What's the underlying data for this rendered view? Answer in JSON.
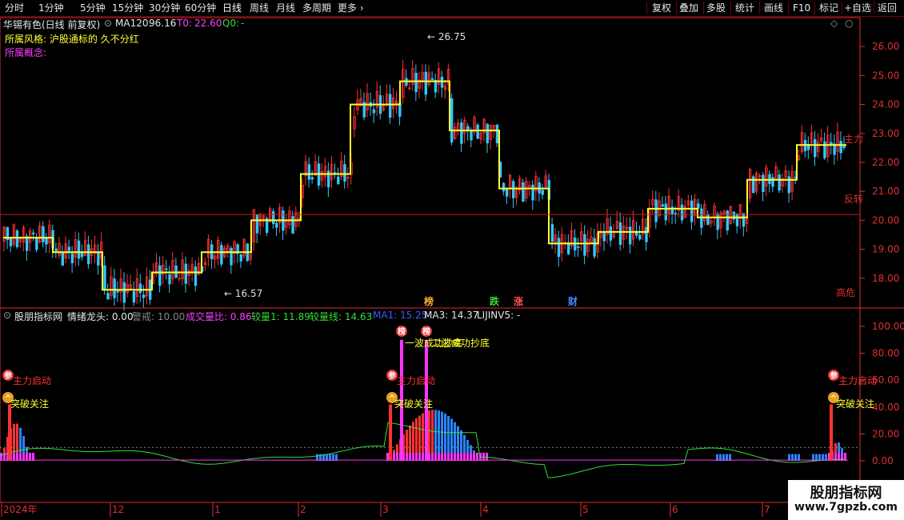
{
  "toolbar": {
    "periods": [
      "分时",
      "1分钟",
      "5分钟",
      "15分钟",
      "30分钟",
      "60分钟",
      "日线",
      "周线",
      "月线",
      "更多"
    ],
    "active_period": "日线",
    "actions": [
      "复权",
      "叠加",
      "多股",
      "统计",
      "画线",
      "F10",
      "标记",
      "+自选",
      "返回"
    ]
  },
  "main_header": {
    "stock": "华锡有色(日线 前复权)",
    "ma120_label": "MA120:",
    "ma120_value": "96.16",
    "t0_label": "T0:",
    "t0_value": "22.60",
    "q0_label": "Q0:",
    "q0_value": "-"
  },
  "notes": {
    "style_label": "所属风格:",
    "style_value": "沪股通标的 久不分红",
    "concept_label": "所属概念:"
  },
  "sub_header": {
    "name": "股朋指标网",
    "qxlt": "情绪龙头: 0.00",
    "jingjie": "警戒: 10.00",
    "cjlb": "成交量比: 0.86",
    "jl1": "较量1: 11.89",
    "jlx": "较量线: 14.63",
    "ma1": "MA1: 15.25",
    "ma3": "MA3: 14.37",
    "lijin": "LIJINV5: -"
  },
  "colors": {
    "up": "#ff3232",
    "down": "#2a84ff",
    "ma": "#ffff33",
    "axis": "#e03030",
    "green": "#33dd33",
    "magenta": "#ff33ff"
  },
  "chart_data": [
    {
      "type": "candlestick",
      "title": "华锡有色(日线 前复权)",
      "y_axis": {
        "ticks": [
          18.0,
          19.0,
          20.0,
          21.0,
          22.0,
          23.0,
          24.0,
          25.0,
          26.0
        ],
        "range": [
          17.0,
          27.0
        ]
      },
      "x_axis_labels": [
        "2024年",
        "12",
        "1",
        "2",
        "3",
        "4",
        "5",
        "6",
        "7"
      ],
      "annotations": {
        "high": "26.75",
        "low": "16.57"
      },
      "markers": [
        "榜",
        "跌",
        "涨",
        "财"
      ],
      "right_labels": [
        "主力",
        "反转",
        "高危"
      ],
      "step_line_levels": [
        19.4,
        18.9,
        17.6,
        18.2,
        18.9,
        20.0,
        21.6,
        24.0,
        24.8,
        23.1,
        21.1,
        19.2,
        19.6,
        20.4,
        20.1,
        21.4,
        22.6
      ]
    },
    {
      "type": "bar",
      "title": "股朋指标网",
      "y_axis": {
        "ticks": [
          0.0,
          20.0,
          40.0,
          60.0,
          80.0,
          100.0
        ],
        "range": [
          -10.0,
          110.0
        ]
      },
      "events": [
        {
          "icon": "参",
          "label": "主力启动"
        },
        {
          "icon": "^",
          "label": "突破关注"
        },
        {
          "icon": "榜",
          "label": "一波成功抄底"
        },
        {
          "icon": "榜",
          "label": "二波成功抄底"
        }
      ],
      "series": [
        {
          "name": "成交量比"
        },
        {
          "name": "较量1"
        },
        {
          "name": "较量线"
        }
      ]
    }
  ]
}
